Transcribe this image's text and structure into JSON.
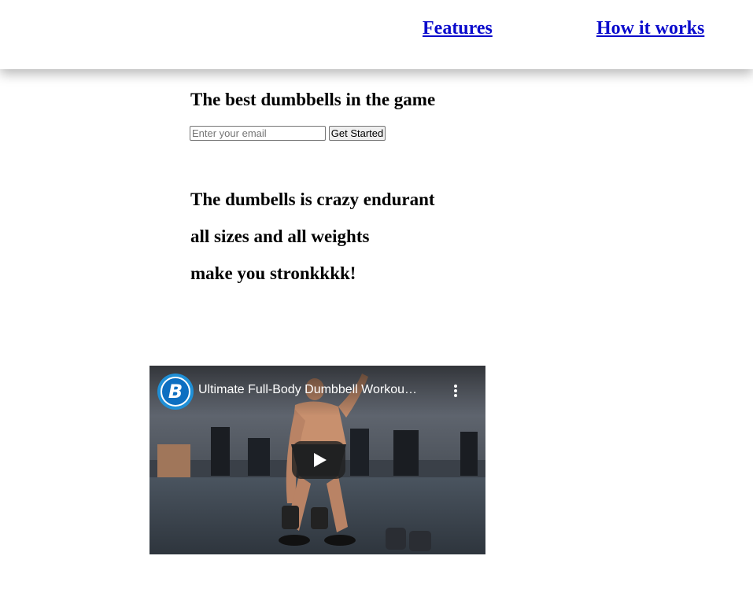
{
  "nav": {
    "features": "Features",
    "how_it_works": "How it works"
  },
  "hero": {
    "title": "The best dumbbells in the game",
    "email_placeholder": "Enter your email",
    "submit_label": "Get Started"
  },
  "features": [
    "The dumbells is crazy endurant",
    "all sizes and all weights",
    "make you stronkkkk!"
  ],
  "video": {
    "title": "Ultimate Full-Body Dumbbell Workou…",
    "channel_logo_letter": "B",
    "channel_color": "#1f8fd6"
  },
  "colors": {
    "link": "#0b0bcc"
  }
}
